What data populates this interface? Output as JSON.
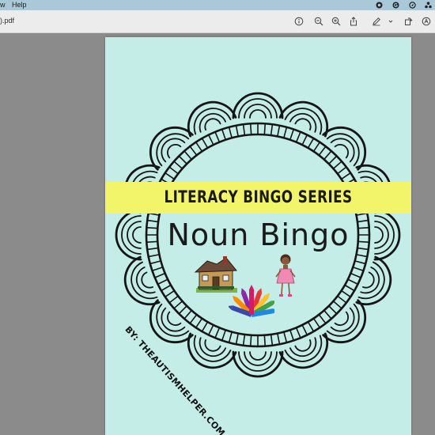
{
  "menubar": {
    "items": [
      {
        "label": "w"
      },
      {
        "label": "Help"
      }
    ],
    "status_icons": [
      "record-icon",
      "grammarly-icon",
      "location-icon",
      "extensions-icon"
    ]
  },
  "toolbar": {
    "document_title": ").pdf",
    "buttons": [
      "info-icon",
      "zoom-out-icon",
      "zoom-in-icon",
      "share-icon",
      "markup-pen-icon",
      "chevron-down-icon",
      "rotate-icon",
      "annotate-icon"
    ]
  },
  "page": {
    "background": "#c4ede7",
    "banner_color": "#f2f46a",
    "series_title": "LITERACY BINGO SERIES",
    "main_title": "Noun Bingo",
    "byline": "BY: THEAUTISMHELPER.COM",
    "illustrations": [
      "house-icon",
      "girl-icon",
      "crayons-icon"
    ]
  }
}
